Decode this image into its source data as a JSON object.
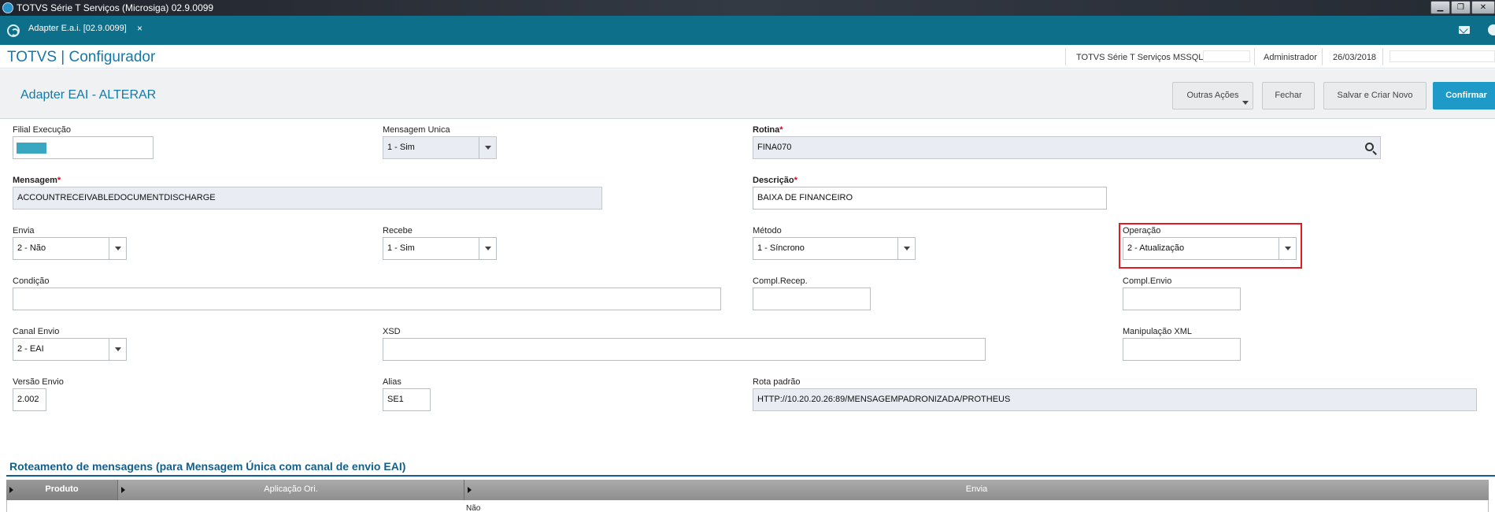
{
  "window": {
    "title": "TOTVS Série T Serviços (Microsiga) 02.9.0099",
    "min": "▁",
    "max": "❐",
    "close": "✕"
  },
  "tabbar": {
    "tab_label": "Adapter E.a.i. [02.9.0099]",
    "tab_close": "×"
  },
  "header": {
    "brand": "TOTVS | Configurador",
    "environment": "TOTVS Série T Serviços MSSQL",
    "user": "Administrador",
    "date": "26/03/2018"
  },
  "actionbar": {
    "title": "Adapter EAI - ALTERAR",
    "more_actions": "Outras Ações",
    "close": "Fechar",
    "save_new": "Salvar e Criar Novo",
    "confirm": "Confirmar"
  },
  "form": {
    "filial": {
      "label": "Filial Execução"
    },
    "mensagem_unica": {
      "label": "Mensagem Unica",
      "value": "1 - Sim"
    },
    "rotina": {
      "label": "Rotina",
      "value": "FINA070"
    },
    "mensagem": {
      "label": "Mensagem",
      "value": "ACCOUNTRECEIVABLEDOCUMENTDISCHARGE"
    },
    "descricao": {
      "label": "Descrição",
      "value": "BAIXA DE FINANCEIRO"
    },
    "envia": {
      "label": "Envia",
      "value": "2 - Não"
    },
    "recebe": {
      "label": "Recebe",
      "value": "1 - Sim"
    },
    "metodo": {
      "label": "Método",
      "value": "1 - Síncrono"
    },
    "operacao": {
      "label": "Operação",
      "value": "2 - Atualização"
    },
    "condicao": {
      "label": "Condição",
      "value": ""
    },
    "compl_recep": {
      "label": "Compl.Recep.",
      "value": ""
    },
    "compl_envio": {
      "label": "Compl.Envio",
      "value": ""
    },
    "canal_envio": {
      "label": "Canal Envio",
      "value": "2 - EAI"
    },
    "xsd": {
      "label": "XSD",
      "value": ""
    },
    "manipulacao_xml": {
      "label": "Manipulação XML",
      "value": ""
    },
    "versao_envio": {
      "label": "Versão Envio",
      "value": "2.002"
    },
    "alias": {
      "label": "Alias",
      "value": "SE1"
    },
    "rota_padrao": {
      "label": "Rota padrão",
      "value": "HTTP://10.20.20.26:89/MENSAGEMPADRONIZADA/PROTHEUS"
    },
    "required_mark": "*"
  },
  "routing": {
    "title": "Roteamento de mensagens (para Mensagem Única com canal de envio EAI)",
    "columns": [
      "Produto",
      "Aplicação Ori.",
      "Envia"
    ],
    "rows": [
      {
        "envia": "Não"
      }
    ]
  },
  "colors": {
    "accent": "#1579a8",
    "tabbar": "#0d6f8a",
    "primary_button": "#1e9ac8",
    "highlight": "#e01c22"
  }
}
